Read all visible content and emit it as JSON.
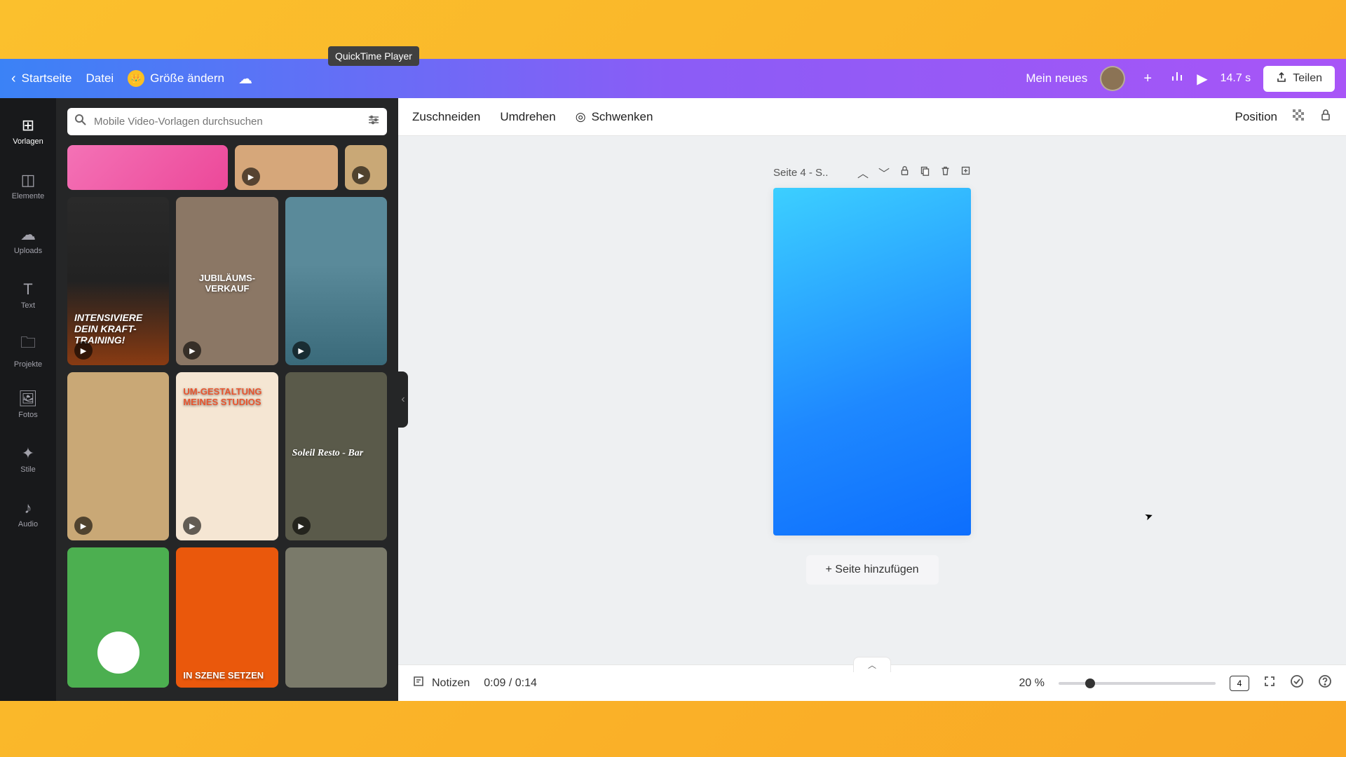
{
  "tooltip": "QuickTime Player",
  "header": {
    "home": "Startseite",
    "file": "Datei",
    "resize": "Größe ändern",
    "project_name": "Mein neues",
    "duration": "14.7 s",
    "share": "Teilen"
  },
  "vert_nav": [
    {
      "icon": "⊞",
      "label": "Vorlagen"
    },
    {
      "icon": "◫",
      "label": "Elemente"
    },
    {
      "icon": "☁",
      "label": "Uploads"
    },
    {
      "icon": "T",
      "label": "Text"
    },
    {
      "icon": "🗀",
      "label": "Projekte"
    },
    {
      "icon": "🖼",
      "label": "Fotos"
    },
    {
      "icon": "✦",
      "label": "Stile"
    },
    {
      "icon": "♪",
      "label": "Audio"
    }
  ],
  "search": {
    "placeholder": "Mobile Video-Vorlagen durchsuchen"
  },
  "templates": {
    "row1": [
      {
        "bg": "linear-gradient(135deg,#f472b6,#ec4899)",
        "text": ""
      },
      {
        "bg": "#d6a77a",
        "text": ""
      }
    ],
    "row2": [
      {
        "bg": "linear-gradient(#1a1a1a,#333)",
        "overlay": "#ea580c",
        "text": "INTENSIVIERE DEIN KRAFT-TRAINING!",
        "textPos": "bottom"
      },
      {
        "bg": "#8b7765",
        "text": "JUBILÄUMS-VERKAUF",
        "textPos": "mid"
      },
      {
        "bg": "linear-gradient(#4a7a8a 40%,#2a5a6a)",
        "text": ""
      }
    ],
    "row3": [
      {
        "bg": "#b8956a",
        "text": ""
      },
      {
        "bg": "#f5e6d3",
        "overlay": "#e8552f",
        "text": "UM-GESTALTUNG MEINES STUDIOS",
        "textPos": "top"
      },
      {
        "bg": "#5a5a4a",
        "text": "Soleil Resto - Bar",
        "textPos": "mid"
      }
    ],
    "row4": [
      {
        "bg": "#4caf50",
        "text": ""
      },
      {
        "bg": "#ea580c",
        "text": "IN SZENE SETZEN",
        "textPos": "bottom"
      },
      {
        "bg": "#6b6b5a",
        "text": ""
      }
    ]
  },
  "canvas_toolbar": {
    "crop": "Zuschneiden",
    "flip": "Umdrehen",
    "pan": "Schwenken",
    "position": "Position"
  },
  "page": {
    "title": "Seite 4 - S..",
    "add_page": "+ Seite hinzufügen"
  },
  "bottom": {
    "notes": "Notizen",
    "time": "0:09 / 0:14",
    "zoom": "20 %",
    "page_count": "4"
  }
}
